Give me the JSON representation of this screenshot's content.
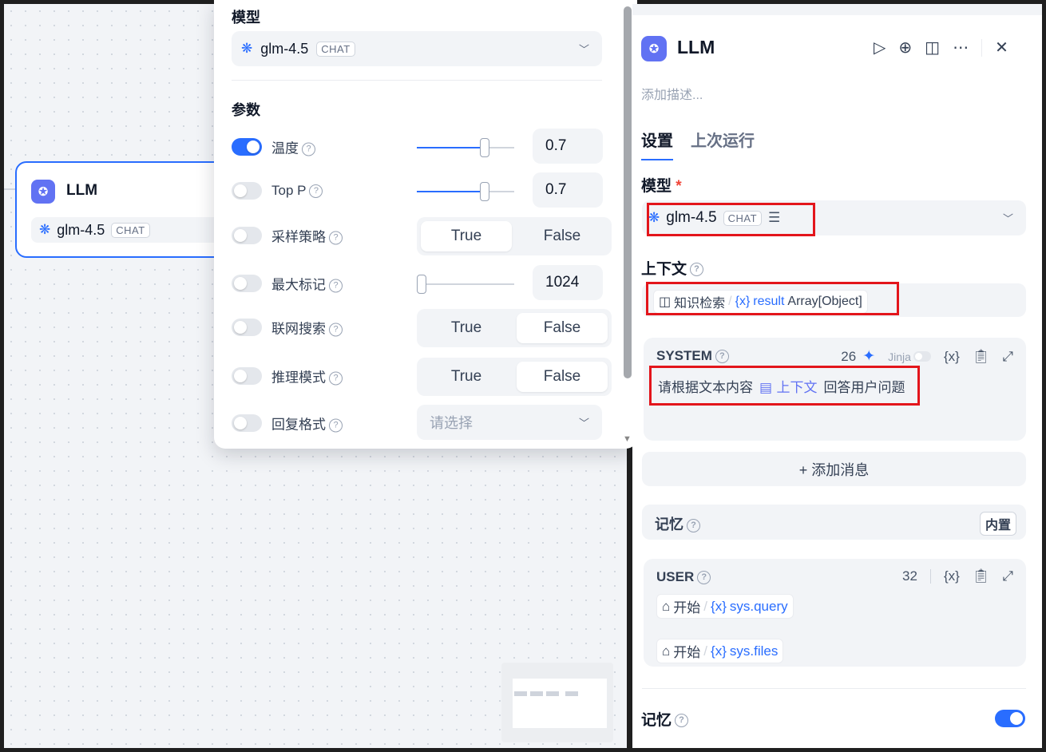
{
  "node": {
    "title": "LLM",
    "model_name": "glm-4.5",
    "model_tag": "CHAT"
  },
  "params_panel": {
    "model_label": "模型",
    "model_name": "glm-4.5",
    "model_tag": "CHAT",
    "section_label": "参数",
    "rows": [
      {
        "label": "温度",
        "enabled": true,
        "value": "0.7",
        "slider_fraction": 0.7
      },
      {
        "label": "Top P",
        "enabled": false,
        "value": "0.7",
        "slider_fraction": 0.7
      },
      {
        "label": "采样策略",
        "enabled": false,
        "options": [
          "True",
          "False"
        ],
        "selected": "True"
      },
      {
        "label": "最大标记",
        "enabled": false,
        "value": "1024",
        "slider_fraction": 0.05
      },
      {
        "label": "联网搜索",
        "enabled": false,
        "options": [
          "True",
          "False"
        ],
        "selected": "False"
      },
      {
        "label": "推理模式",
        "enabled": false,
        "options": [
          "True",
          "False"
        ],
        "selected": "False"
      },
      {
        "label": "回复格式",
        "enabled": false,
        "placeholder": "请选择"
      }
    ]
  },
  "right_panel": {
    "title": "LLM",
    "description_placeholder": "添加描述...",
    "tabs": [
      {
        "label": "设置",
        "active": true
      },
      {
        "label": "上次运行",
        "active": false
      }
    ],
    "model_section": {
      "label": "模型",
      "required_mark": "*",
      "model_name": "glm-4.5",
      "model_tag": "CHAT"
    },
    "context_section": {
      "label": "上下文",
      "source_node": "知识检索",
      "var_icon": "{x}",
      "var_name": "result",
      "var_type": "Array[Object]"
    },
    "system_prompt": {
      "role": "SYSTEM",
      "token_count": "26",
      "jinja_label": "Jinja",
      "text_before": "请根据文本内容",
      "context_ref": "上下文",
      "text_after": "回答用户问题"
    },
    "add_message_label": "+ 添加消息",
    "memory_box": {
      "label": "记忆",
      "badge": "内置"
    },
    "user_prompt": {
      "role": "USER",
      "token_count": "32",
      "vars": [
        {
          "node": "开始",
          "var": "sys.query"
        },
        {
          "node": "开始",
          "var": "sys.files"
        }
      ]
    },
    "memory_section": {
      "label": "记忆",
      "enabled": true
    }
  },
  "colors": {
    "accent": "#296dff",
    "node_icon": "#6172f3",
    "highlight_box": "#e3151b"
  }
}
